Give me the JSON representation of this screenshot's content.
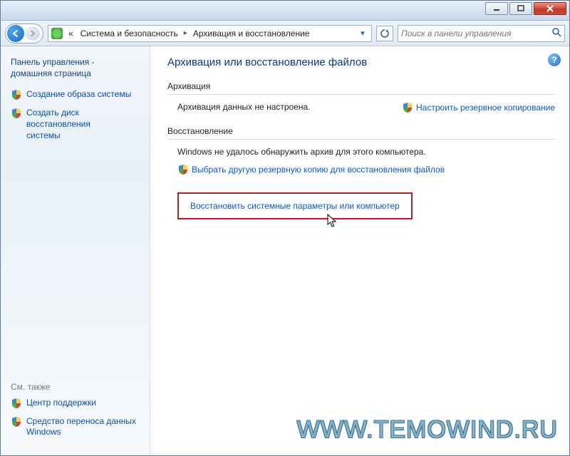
{
  "titlebar": {},
  "nav": {
    "breadcrumb_prefix": "«",
    "crumb1": "Система и безопасность",
    "crumb2": "Архивация и восстановление"
  },
  "search": {
    "placeholder": "Поиск в панели управления"
  },
  "sidebar": {
    "cp_home_line1": "Панель управления -",
    "cp_home_line2": "домашняя страница",
    "link_create_image": "Создание образа системы",
    "link_create_recovery_disc_l1": "Создать диск восстановления",
    "link_create_recovery_disc_l2": "системы",
    "see_also": "См. также",
    "link_action_center": "Центр поддержки",
    "link_easy_transfer_l1": "Средство переноса данных",
    "link_easy_transfer_l2": "Windows"
  },
  "main": {
    "title": "Архивация или восстановление файлов",
    "backup_hdr": "Архивация",
    "backup_status": "Архивация данных не настроена.",
    "backup_action": "Настроить резервное копирование",
    "restore_hdr": "Восстановление",
    "restore_status": "Windows не удалось обнаружить архив для этого компьютера.",
    "restore_action1": "Выбрать другую резервную копию для восстановления файлов",
    "restore_action2": "Восстановить системные параметры или компьютер"
  },
  "watermark": "WWW.TEMOWIND.RU"
}
